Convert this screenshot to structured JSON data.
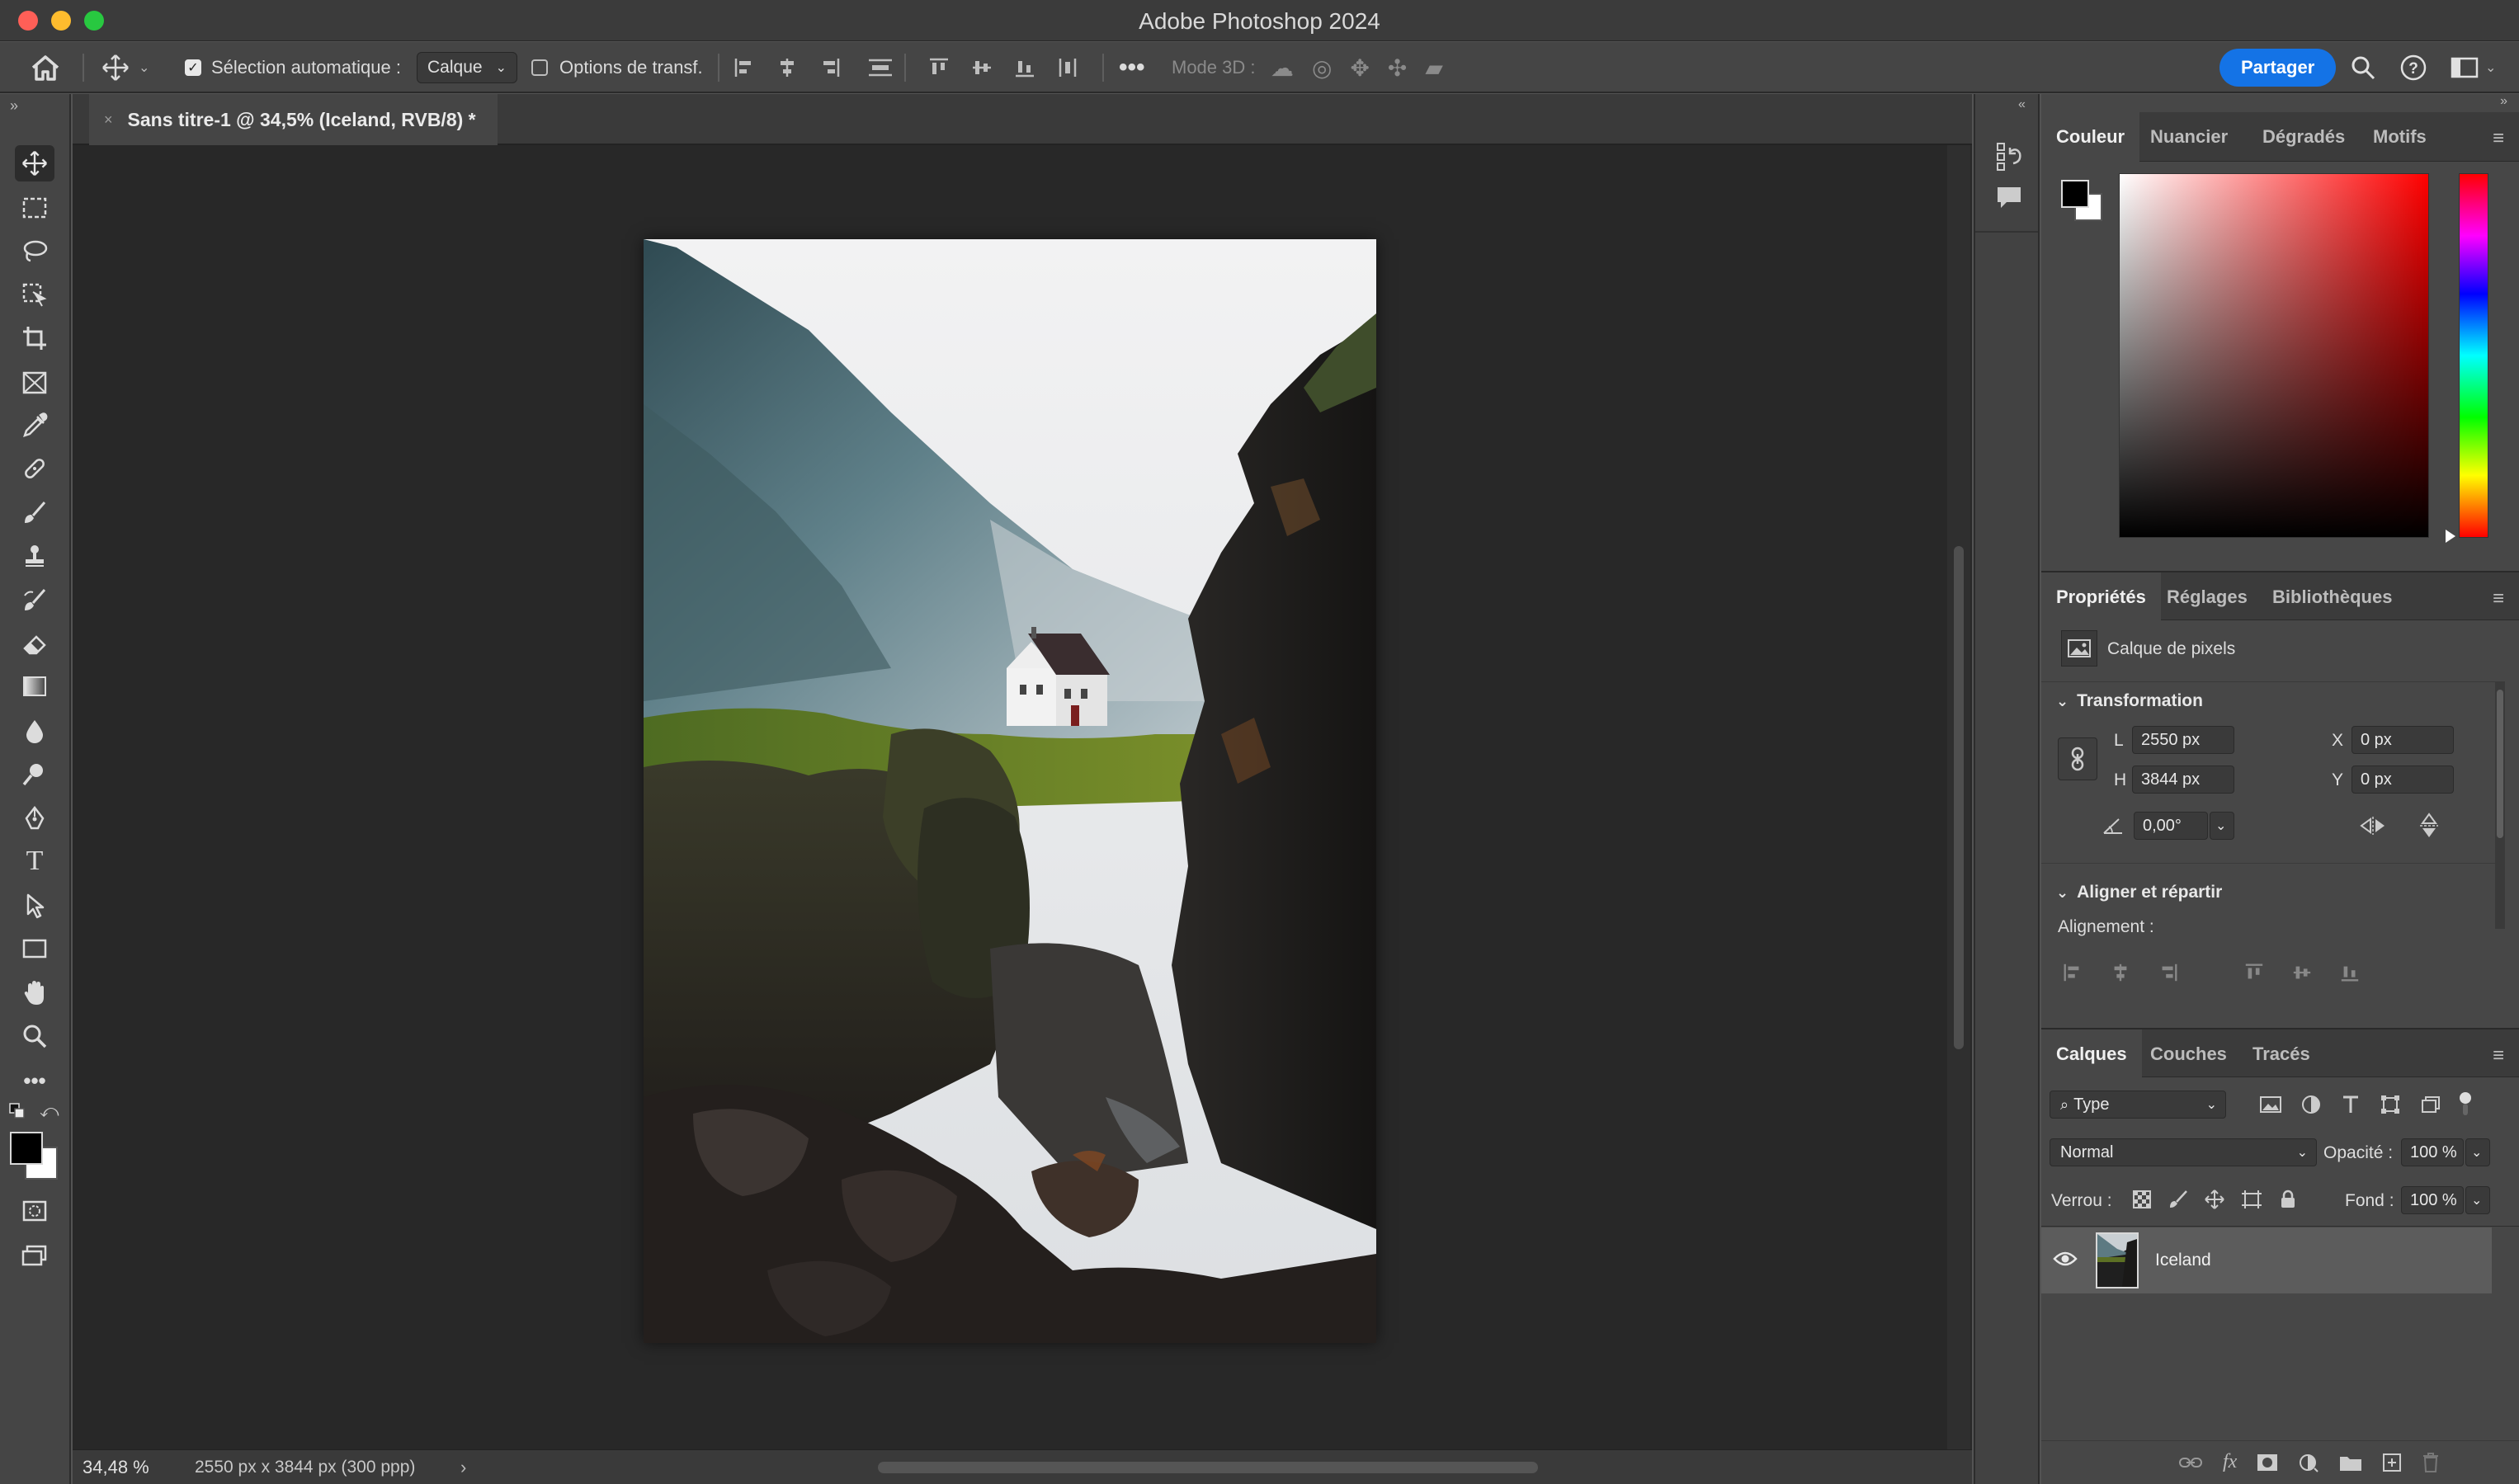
{
  "window": {
    "title": "Adobe Photoshop 2024",
    "traffic_colors": [
      "#ff5f57",
      "#febc2e",
      "#28c840"
    ]
  },
  "options_bar": {
    "auto_select_label": "Sélection automatique :",
    "auto_select_checked": true,
    "auto_select_target": "Calque",
    "transform_options_label": "Options de transf.",
    "transform_options_checked": false,
    "mode_3d_label": "Mode 3D :",
    "share_button": "Partager",
    "accent": "#1473e6"
  },
  "document": {
    "tab_title": "Sans titre-1 @ 34,5% (Iceland, RVB/8) *",
    "zoom": "34,48 %",
    "doc_info": "2550 px x 3844 px (300 ppp)"
  },
  "color_panel": {
    "tabs": [
      "Couleur",
      "Nuancier",
      "Dégradés",
      "Motifs"
    ],
    "active_tab": "Couleur",
    "foreground": "#000000",
    "background": "#ffffff",
    "hue_base": "#ff0000"
  },
  "properties_panel": {
    "tabs": [
      "Propriétés",
      "Réglages",
      "Bibliothèques"
    ],
    "active_tab": "Propriétés",
    "layer_type": "Calque de pixels",
    "transform_header": "Transformation",
    "w_label": "L",
    "w_value": "2550 px",
    "h_label": "H",
    "h_value": "3844 px",
    "x_label": "X",
    "x_value": "0 px",
    "y_label": "Y",
    "y_value": "0 px",
    "angle_value": "0,00°",
    "align_header": "Aligner et répartir",
    "alignment_label": "Alignement :"
  },
  "layers_panel": {
    "tabs": [
      "Calques",
      "Couches",
      "Tracés"
    ],
    "active_tab": "Calques",
    "filter_label": "Type",
    "blend_mode": "Normal",
    "opacity_label": "Opacité :",
    "opacity_value": "100 %",
    "lock_label": "Verrou :",
    "fill_label": "Fond :",
    "fill_value": "100 %",
    "layers": [
      {
        "name": "Iceland",
        "visible": true,
        "selected": true
      }
    ]
  }
}
